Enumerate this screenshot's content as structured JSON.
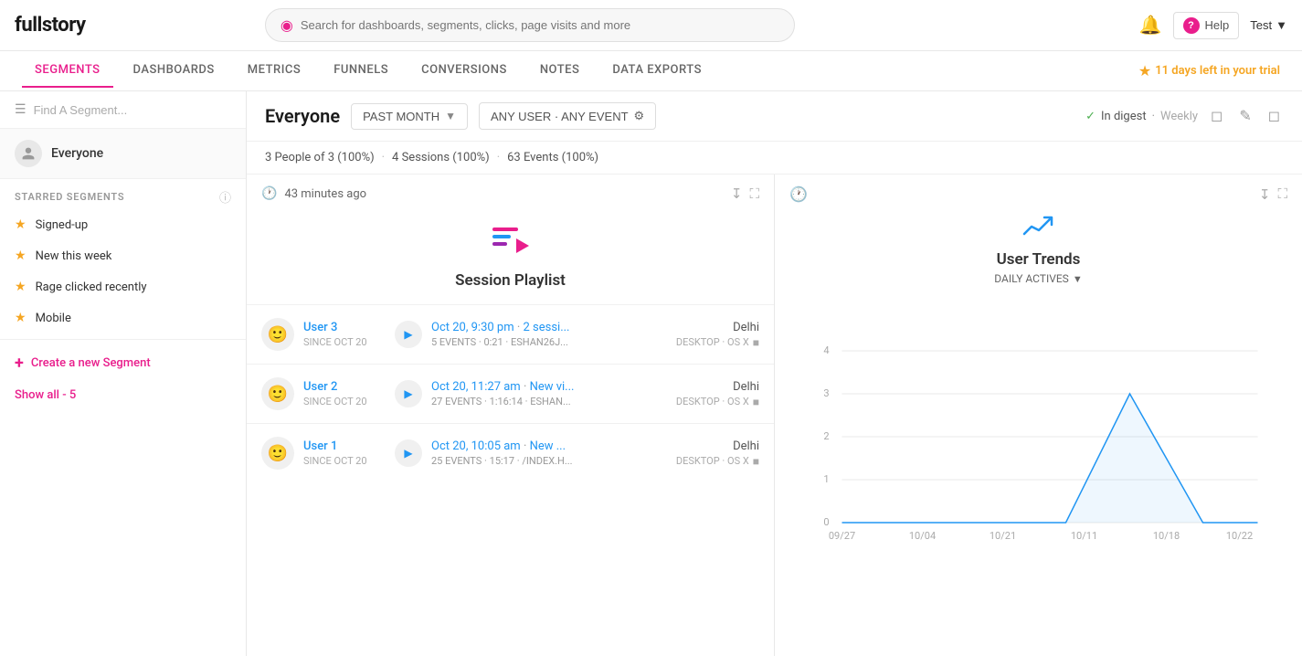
{
  "topbar": {
    "logo": "fullstory",
    "search_placeholder": "Search for dashboards, segments, clicks, page visits and more",
    "help_label": "Help",
    "user_label": "Test",
    "trial_text": "11 days left in your trial"
  },
  "nav": {
    "items": [
      {
        "label": "SEGMENTS",
        "active": true
      },
      {
        "label": "DASHBOARDS",
        "active": false
      },
      {
        "label": "METRICS",
        "active": false
      },
      {
        "label": "FUNNELS",
        "active": false
      },
      {
        "label": "CONVERSIONS",
        "active": false
      },
      {
        "label": "NOTES",
        "active": false
      },
      {
        "label": "DATA EXPORTS",
        "active": false
      }
    ]
  },
  "sidebar": {
    "search_placeholder": "Find A Segment...",
    "everyone_label": "Everyone",
    "starred_title": "STARRED SEGMENTS",
    "segments": [
      {
        "label": "Signed-up",
        "starred": true
      },
      {
        "label": "New this week",
        "starred": true
      },
      {
        "label": "Rage clicked recently",
        "starred": true
      },
      {
        "label": "Mobile",
        "starred": true
      }
    ],
    "create_label": "Create a new Segment",
    "show_all": "Show all - 5"
  },
  "content": {
    "title": "Everyone",
    "filter_label": "PAST MONTH",
    "event_filter_label": "ANY USER · ANY EVENT",
    "digest_label": "In digest",
    "digest_period": "Weekly",
    "stats": {
      "people": "3 People of 3 (100%)",
      "sessions": "4 Sessions (100%)",
      "events": "63 Events (100%)"
    }
  },
  "session_panel": {
    "time_ago": "43 minutes ago",
    "title": "Session Playlist",
    "sessions": [
      {
        "user": "User 3",
        "since": "SINCE OCT 20",
        "time": "Oct 20, 9:30 pm",
        "session_info": "2 sessi...",
        "events": "5 EVENTS · 0:21 · ESHAN26J...",
        "location": "Delhi",
        "device": "DESKTOP · OS X"
      },
      {
        "user": "User 2",
        "since": "SINCE OCT 20",
        "time": "Oct 20, 11:27 am",
        "session_info": "New vi...",
        "events": "27 EVENTS · 1:16:14 · ESHAN...",
        "location": "Delhi",
        "device": "DESKTOP · OS X"
      },
      {
        "user": "User 1",
        "since": "SINCE OCT 20",
        "time": "Oct 20, 10:05 am",
        "session_info": "New ...",
        "events": "25 EVENTS · 15:17 · /INDEX.H...",
        "location": "Delhi",
        "device": "DESKTOP · OS X"
      }
    ]
  },
  "trend_panel": {
    "title": "User Trends",
    "subtitle": "DAILY ACTIVES",
    "chart": {
      "x_labels": [
        "09/27",
        "10/04",
        "10/21",
        "10/11",
        "10/18",
        "10/22"
      ],
      "y_labels": [
        "0",
        "1",
        "2",
        "3",
        "4"
      ],
      "color": "#2196f3",
      "data_points": [
        {
          "x": 0.02,
          "y": 0
        },
        {
          "x": 0.1,
          "y": 0
        },
        {
          "x": 0.28,
          "y": 0
        },
        {
          "x": 0.46,
          "y": 0
        },
        {
          "x": 0.82,
          "y": 3
        },
        {
          "x": 0.96,
          "y": 0.2
        }
      ]
    }
  }
}
